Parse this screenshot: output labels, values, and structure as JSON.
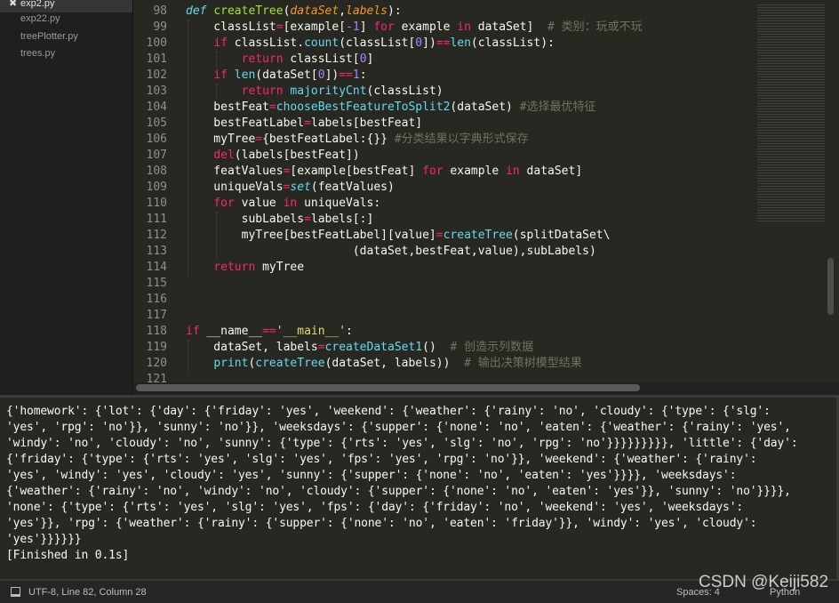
{
  "sidebar": {
    "files": [
      {
        "name": "exp2.py",
        "active": true
      },
      {
        "name": "exp22.py"
      },
      {
        "name": "treePlotter.py"
      },
      {
        "name": "trees.py"
      }
    ]
  },
  "editor": {
    "lines": [
      {
        "n": "98",
        "t": [
          [
            "def",
            "d"
          ],
          " ",
          [
            "createTree",
            "g"
          ],
          "(",
          [
            "dataSet",
            "p"
          ],
          ",",
          [
            "labels",
            "p"
          ],
          "):"
        ]
      },
      {
        "n": "99",
        "t": [
          "    classList",
          [
            "=",
            "o"
          ],
          "[example[",
          [
            "-1",
            "n"
          ],
          "] ",
          [
            "for",
            "k"
          ],
          " example ",
          [
            "in",
            "k"
          ],
          " dataSet]  ",
          [
            "# 类别：玩或不玩",
            "c"
          ]
        ]
      },
      {
        "n": "100",
        "t": [
          "    ",
          [
            "if",
            "k"
          ],
          " classList.",
          [
            "count",
            "f"
          ],
          "(classList[",
          [
            "0",
            "n"
          ],
          "])",
          [
            "==",
            "o"
          ],
          [
            "len",
            "f"
          ],
          "(classList):"
        ]
      },
      {
        "n": "101",
        "t": [
          "        ",
          [
            "return",
            "k"
          ],
          " classList[",
          [
            "0",
            "n"
          ],
          "]"
        ]
      },
      {
        "n": "102",
        "t": [
          "    ",
          [
            "if",
            "k"
          ],
          " ",
          [
            "len",
            "f"
          ],
          "(dataSet[",
          [
            "0",
            "n"
          ],
          "])",
          [
            "==",
            "o"
          ],
          [
            "1",
            "n"
          ],
          ":"
        ]
      },
      {
        "n": "103",
        "t": [
          "        ",
          [
            "return",
            "k"
          ],
          " ",
          [
            "majorityCnt",
            "f"
          ],
          "(classList)"
        ]
      },
      {
        "n": "104",
        "t": [
          "    bestFeat",
          [
            "=",
            "o"
          ],
          [
            "chooseBestFeatureToSplit2",
            "f"
          ],
          "(dataSet) ",
          [
            "#选择最优特征",
            "c"
          ]
        ]
      },
      {
        "n": "105",
        "t": [
          "    bestFeatLabel",
          [
            "=",
            "o"
          ],
          "labels[bestFeat]"
        ]
      },
      {
        "n": "106",
        "t": [
          "    myTree",
          [
            "=",
            "o"
          ],
          "{bestFeatLabel:{}} ",
          [
            "#分类结果以字典形式保存",
            "c"
          ]
        ]
      },
      {
        "n": "107",
        "t": [
          "    ",
          [
            "del",
            "k"
          ],
          "(labels[bestFeat])"
        ]
      },
      {
        "n": "108",
        "t": [
          "    featValues",
          [
            "=",
            "o"
          ],
          "[example[bestFeat] ",
          [
            "for",
            "k"
          ],
          " example ",
          [
            "in",
            "k"
          ],
          " dataSet]"
        ]
      },
      {
        "n": "109",
        "t": [
          "    uniqueVals",
          [
            "=",
            "o"
          ],
          [
            "set",
            "fi"
          ],
          "(featValues)"
        ]
      },
      {
        "n": "110",
        "t": [
          "    ",
          [
            "for",
            "k"
          ],
          " value ",
          [
            "in",
            "k"
          ],
          " uniqueVals:"
        ]
      },
      {
        "n": "111",
        "t": [
          "        subLabels",
          [
            "=",
            "o"
          ],
          "labels[:]"
        ]
      },
      {
        "n": "112",
        "t": [
          "        myTree[bestFeatLabel][value]",
          [
            "=",
            "o"
          ],
          [
            "createTree",
            "f"
          ],
          "(splitDataSet\\"
        ]
      },
      {
        "n": "113",
        "t": [
          "                        (dataSet,bestFeat,value),subLabels)"
        ]
      },
      {
        "n": "114",
        "t": [
          "    ",
          [
            "return",
            "k"
          ],
          " myTree"
        ]
      },
      {
        "n": "115",
        "t": []
      },
      {
        "n": "116",
        "t": []
      },
      {
        "n": "117",
        "t": []
      },
      {
        "n": "118",
        "t": [
          [
            "if",
            "k"
          ],
          " __name__",
          [
            "==",
            "o"
          ],
          [
            "'__main__'",
            "s"
          ],
          ":"
        ]
      },
      {
        "n": "119",
        "t": [
          "    dataSet, labels",
          [
            "=",
            "o"
          ],
          [
            "createDataSet1",
            "f"
          ],
          "()  ",
          [
            "# 创造示列数据",
            "c"
          ]
        ]
      },
      {
        "n": "120",
        "t": [
          "    ",
          [
            "print",
            "f"
          ],
          "(",
          [
            "createTree",
            "f"
          ],
          "(dataSet, labels))  ",
          [
            "# 输出决策树模型结果",
            "c"
          ]
        ]
      },
      {
        "n": "121",
        "t": []
      }
    ]
  },
  "output": {
    "lines": [
      "{'homework': {'lot': {'day': {'friday': 'yes', 'weekend': {'weather': {'rainy': 'no', 'cloudy': {'type': {'slg':",
      "'yes', 'rpg': 'no'}}, 'sunny': 'no'}}, 'weeksdays': {'supper': {'none': 'no', 'eaten': {'weather': {'rainy': 'yes',",
      "'windy': 'no', 'cloudy': 'no', 'sunny': {'type': {'rts': 'yes', 'slg': 'no', 'rpg': 'no'}}}}}}}}}, 'little': {'day':",
      "{'friday': {'type': {'rts': 'yes', 'slg': 'yes', 'fps': 'yes', 'rpg': 'no'}}, 'weekend': {'weather': {'rainy':",
      "'yes', 'windy': 'yes', 'cloudy': 'yes', 'sunny': {'supper': {'none': 'no', 'eaten': 'yes'}}}}, 'weeksdays':",
      "{'weather': {'rainy': 'no', 'windy': 'no', 'cloudy': {'supper': {'none': 'no', 'eaten': 'yes'}}, 'sunny': 'no'}}}},",
      "'none': {'type': {'rts': 'yes', 'slg': 'yes', 'fps': {'day': {'friday': 'no', 'weekend': 'yes', 'weeksdays':",
      "'yes'}}, 'rpg': {'weather': {'rainy': {'supper': {'none': 'no', 'eaten': 'friday'}}, 'windy': 'yes', 'cloudy':",
      "'yes'}}}}}}",
      "[Finished in 0.1s]"
    ]
  },
  "status": {
    "left": "UTF-8, Line 82, Column 28",
    "spaces": "Spaces: 4",
    "syntax": "Python"
  },
  "watermark": "CSDN @Keiji582",
  "colors": {
    "background": "#272822",
    "keyword": "#f92672",
    "function": "#66d9ef",
    "def_name": "#a6e22e",
    "param": "#fd971f",
    "number": "#ae81ff",
    "string": "#e6db74",
    "comment": "#75715e"
  }
}
